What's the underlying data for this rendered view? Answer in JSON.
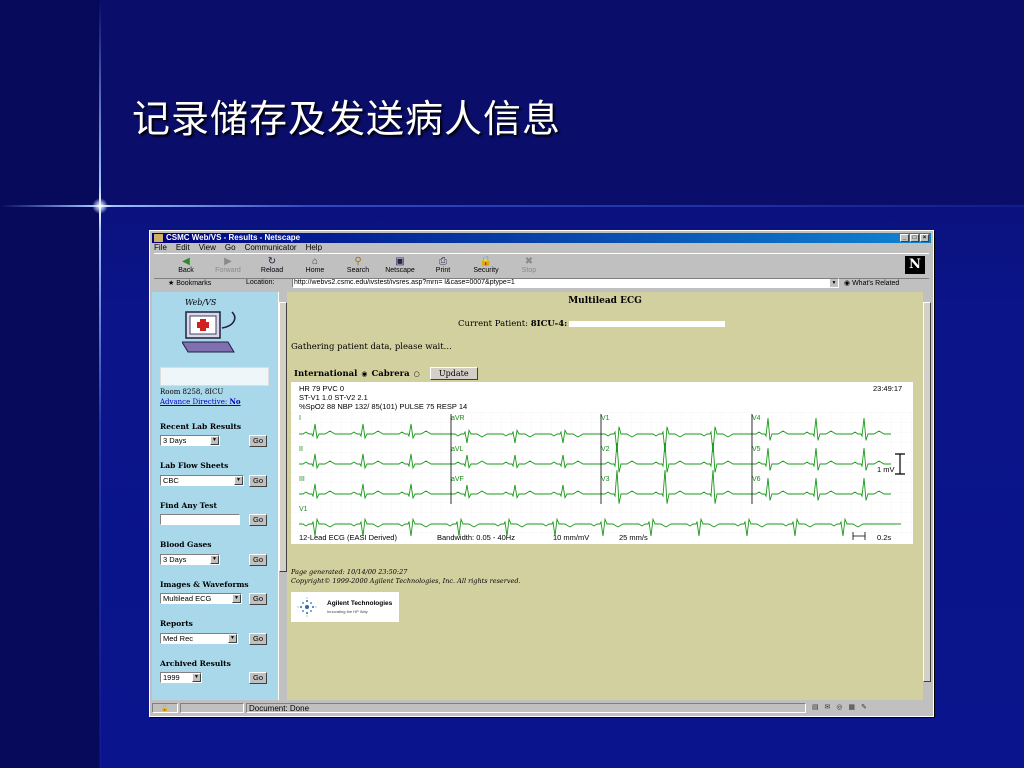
{
  "slide": {
    "title": "记录储存及发送病人信息"
  },
  "browser": {
    "window_title": "CSMC Web/VS - Results - Netscape",
    "menu": [
      "File",
      "Edit",
      "View",
      "Go",
      "Communicator",
      "Help"
    ],
    "toolbar": [
      "Back",
      "Forward",
      "Reload",
      "Home",
      "Search",
      "Netscape",
      "Print",
      "Security",
      "Stop"
    ],
    "bookmarks_label": "Bookmarks",
    "location_label": "Location:",
    "url": "http://webvs2.csmc.edu/ivstest/ivsres.asp?mrn=            l&case=0007&ptype=1",
    "whats_related": "What's Related",
    "status": "Document: Done"
  },
  "sidebar": {
    "logo": "Web/VS",
    "room": "Room 8258, 8ICU",
    "advance_directive": "Advance Directive:",
    "advance_value": "No",
    "go_label": "Go",
    "sections": [
      {
        "title": "Recent Lab Results",
        "value": "3 Days"
      },
      {
        "title": "Lab Flow Sheets",
        "value": "CBC"
      },
      {
        "title": "Find Any Test",
        "value": ""
      },
      {
        "title": "Blood Gases",
        "value": "3 Days"
      },
      {
        "title": "Images & Waveforms",
        "value": "Multilead ECG"
      },
      {
        "title": "Reports",
        "value": "Med Rec"
      },
      {
        "title": "Archived Results",
        "value": "1999"
      }
    ]
  },
  "main": {
    "title": "Multilead ECG",
    "patient_label": "Current Patient:",
    "patient_id": "8ICU-4:",
    "gathering": "Gathering patient data, please wait...",
    "radio_international": "International",
    "radio_cabrera": "Cabrera",
    "update_label": "Update",
    "ecg": {
      "vitals_line1": "HR 79   PVC 0",
      "vitals_line2": "ST-V1 1.0   ST-V2 2.1",
      "vitals_line3": "%SpO2 88   NBP 132/ 85(101)   PULSE 75   RESP 14",
      "time": "23:49:17",
      "col1_leads": [
        "I",
        "II",
        "III",
        "V1"
      ],
      "col2_leads": [
        "aVR",
        "aVL",
        "aVF"
      ],
      "col3_leads": [
        "V1",
        "V2",
        "V3"
      ],
      "col4_leads": [
        "V4",
        "V5",
        "V6"
      ],
      "calibration": "1 mV",
      "footer_mode": "12-Lead ECG (EASI Derived)",
      "footer_bandwidth": "Bandwidth: 0.05 - 40Hz",
      "footer_gain": "10 mm/mV",
      "footer_speed": "25 mm/s",
      "footer_scale": "0.2s",
      "trace_color": "#1a9a1a"
    },
    "generated": "Page generated: 10/14/00 23:50:27",
    "copyright": "Copyright© 1999-2000 Agilent Technologies, Inc. All rights reserved.",
    "agilent_name": "Agilent Technologies",
    "agilent_tagline": "Innovating the HP Way"
  }
}
